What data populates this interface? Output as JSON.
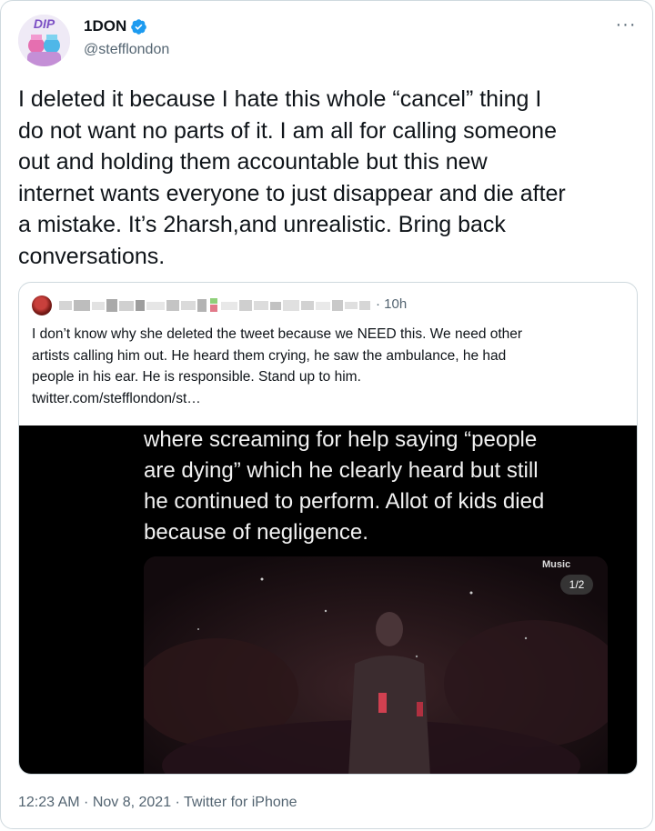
{
  "author": {
    "name": "1DON",
    "handle": "@stefflondon",
    "avatar_text": "DIP",
    "verified": true
  },
  "more_label": "···",
  "tweet_text": "I deleted it because I hate this whole “cancel” thing I\ndo not want no parts of it. I am all for calling someone\nout and holding them accountable but this new\ninternet wants everyone to just disappear and die after\na mistake. It’s 2harsh,and unrealistic. Bring back\nconversations.",
  "quote": {
    "time": "· 10h",
    "text": "I don’t know why she deleted the tweet because we NEED this. We need other\nartists calling him out. He heard them crying, he saw the ambulance, he had\npeople in his ear. He is responsible. Stand up to him.\ntwitter.com/stefflondon/st…",
    "media_text": "where screaming for help saying “people\nare dying” which he clearly heard but still\nhe continued to perform. Allot of kids died\nbecause of negligence.",
    "music_badge": "Music",
    "media_counter": "1/2"
  },
  "meta": "12:23 AM · Nov 8, 2021 · Twitter for iPhone",
  "colors": {
    "text": "#0f1419",
    "secondary": "#536471",
    "border": "#cfd9de",
    "verified": "#1d9bf0",
    "avatar_logo": "#7b4fc4"
  }
}
